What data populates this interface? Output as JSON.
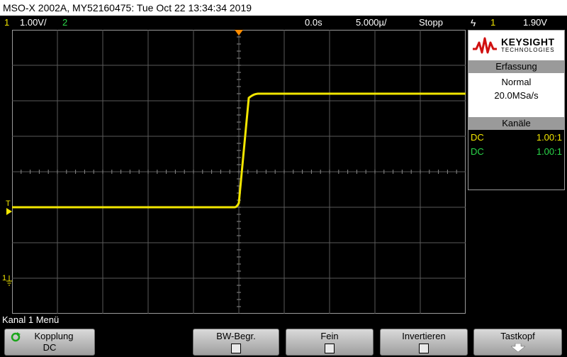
{
  "title_bar": "MSO-X 2002A, MY52160475: Tue Oct 22 13:34:34 2019",
  "status": {
    "ch1_number": "1",
    "ch1_scale": "1.00V/",
    "ch2_number": "2",
    "time_delay": "0.0s",
    "time_scale": "5.000µ/",
    "run_state": "Stopp",
    "trigger_icon": "ϟ",
    "trigger_source": "1",
    "trigger_level": "1.90V"
  },
  "side_panel": {
    "logo_brand": "KEYSIGHT",
    "logo_sub": "TECHNOLOGIES",
    "acquisition_header": "Erfassung",
    "acquisition_mode": "Normal",
    "sample_rate": "20.0MSa/s",
    "channels_header": "Kanäle",
    "channels": [
      {
        "coupling": "DC",
        "ratio": "1.00:1",
        "color": "#f2e600"
      },
      {
        "coupling": "DC",
        "ratio": "1.00:1",
        "color": "#2ad84a"
      }
    ]
  },
  "markers": {
    "trigger_level_marker": "T",
    "ch1_ground_marker": "1"
  },
  "menu_title": "Kanal 1 Menü",
  "softkeys": {
    "kopplung_label": "Kopplung",
    "kopplung_value": "DC",
    "bw_label": "BW-Begr.",
    "fein_label": "Fein",
    "invert_label": "Invertieren",
    "probe_label": "Tastkopf"
  },
  "colors": {
    "ch1": "#f2e600",
    "ch2": "#2ad84a",
    "trigger_marker": "#ff8c00",
    "grid": "#5a5a5a",
    "brand_red": "#d01010"
  },
  "waveform": {
    "ch1_low_divisions": -1.0,
    "ch1_high_divisions": 2.2,
    "edge_time_divisions": 0.0
  }
}
